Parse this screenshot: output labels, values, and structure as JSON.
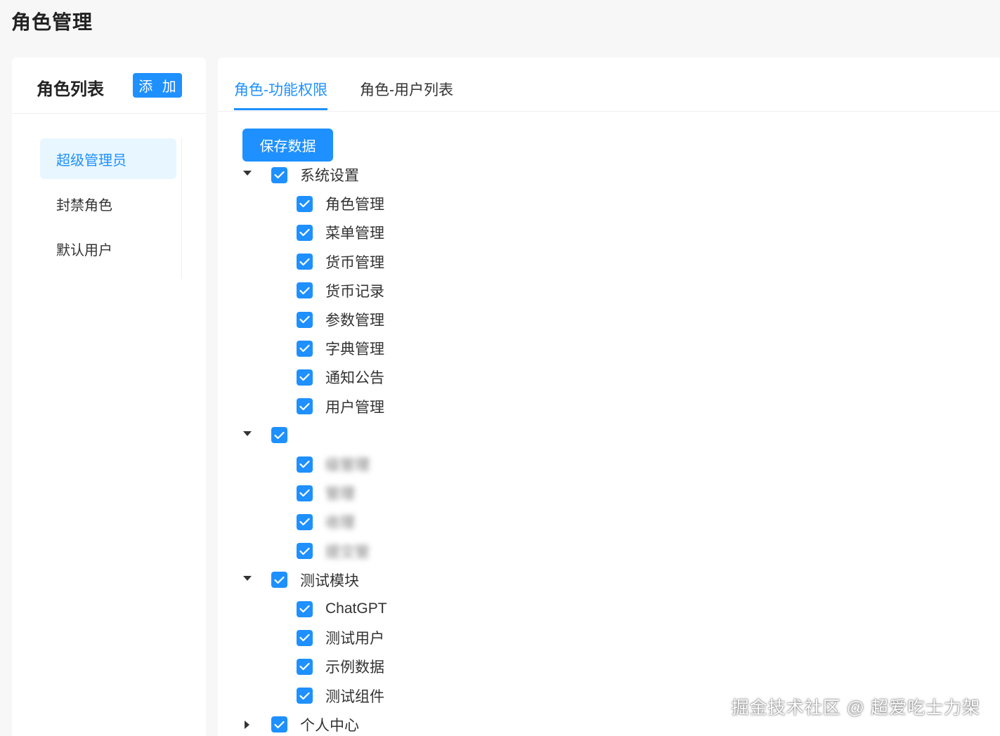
{
  "page": {
    "title": "角色管理"
  },
  "roles_panel": {
    "title": "角色列表",
    "add_label": "添 加",
    "items": [
      {
        "label": "超级管理员",
        "active": true
      },
      {
        "label": "封禁角色",
        "active": false
      },
      {
        "label": "默认用户",
        "active": false
      }
    ]
  },
  "tabs": [
    {
      "label": "角色-功能权限",
      "active": true
    },
    {
      "label": "角色-用户列表",
      "active": false
    }
  ],
  "save_label": "保存数据",
  "tree": [
    {
      "label": "系统设置",
      "checked": true,
      "expanded": true,
      "children": [
        {
          "label": "角色管理",
          "checked": true
        },
        {
          "label": "菜单管理",
          "checked": true
        },
        {
          "label": "货币管理",
          "checked": true
        },
        {
          "label": "货币记录",
          "checked": true
        },
        {
          "label": "参数管理",
          "checked": true
        },
        {
          "label": "字典管理",
          "checked": true
        },
        {
          "label": "通知公告",
          "checked": true
        },
        {
          "label": "用户管理",
          "checked": true
        }
      ]
    },
    {
      "label": "",
      "checked": true,
      "expanded": true,
      "blurred": true,
      "children": [
        {
          "label": "级管理",
          "checked": true,
          "blurred": true
        },
        {
          "label": "管理",
          "checked": true,
          "blurred": true
        },
        {
          "label": "收理",
          "checked": true,
          "blurred": true
        },
        {
          "label": "提交管",
          "checked": true,
          "blurred": true
        }
      ]
    },
    {
      "label": "测试模块",
      "checked": true,
      "expanded": true,
      "children": [
        {
          "label": "ChatGPT",
          "checked": true
        },
        {
          "label": "测试用户",
          "checked": true
        },
        {
          "label": "示例数据",
          "checked": true
        },
        {
          "label": "测试组件",
          "checked": true
        }
      ]
    },
    {
      "label": "个人中心",
      "checked": true,
      "expanded": false,
      "children": []
    }
  ],
  "watermark": "掘金技术社区 @ 超爱吃士力架",
  "colors": {
    "accent": "#1e90ff",
    "active_bg": "#e8f6ff"
  },
  "icons": {
    "check": "check-icon",
    "caret_down": "caret-down-icon",
    "caret_right": "caret-right-icon"
  }
}
